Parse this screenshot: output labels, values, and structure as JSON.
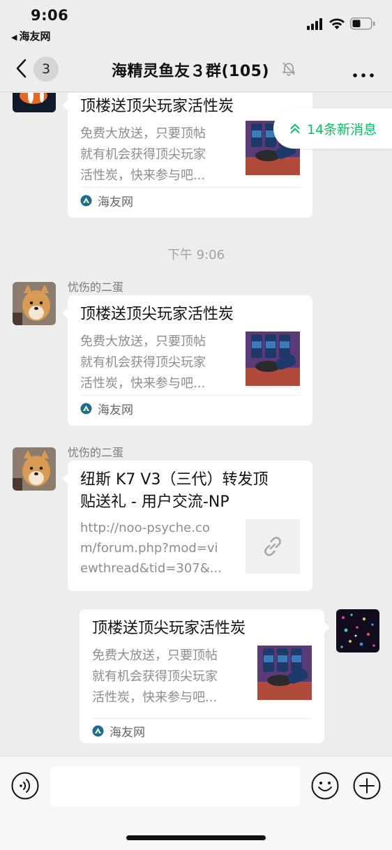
{
  "status_bar": {
    "time": "9:06",
    "back_app": "海友网"
  },
  "nav": {
    "back_count": "3",
    "title": "海精灵鱼友３群(105)"
  },
  "new_messages": {
    "label": "14条新消息"
  },
  "messages": [
    {
      "card": {
        "title": "顶楼送顶尖玩家活性炭",
        "desc_lines": [
          "免费大放送，只要顶帖",
          "就有机会获得顶尖玩家",
          "活性炭，快来参与吧..."
        ],
        "source": "海友网"
      }
    },
    {
      "timestamp": "下午 9:06"
    },
    {
      "sender": "忧伤的二蛋",
      "card": {
        "title": "顶楼送顶尖玩家活性炭",
        "desc_lines": [
          "免费大放送，只要顶帖",
          "就有机会获得顶尖玩家",
          "活性炭，快来参与吧..."
        ],
        "source": "海友网"
      }
    },
    {
      "sender": "忧伤的二蛋",
      "card": {
        "title_lines": [
          "纽斯 K7 V3（三代）转发顶",
          "贴送礼 - 用户交流-NP"
        ],
        "desc_lines": [
          "http://noo-psyche.co",
          "m/forum.php?mod=vi",
          "ewthread&tid=307&..."
        ]
      }
    },
    {
      "card": {
        "title": "顶楼送顶尖玩家活性炭",
        "desc_lines": [
          "免费大放送，只要顶帖",
          "就有机会获得顶尖玩家",
          "活性炭，快来参与吧..."
        ],
        "source": "海友网"
      }
    }
  ],
  "icons": {
    "back": "chevron-left-icon",
    "mute": "bell-slash-icon",
    "more": "more-dots-icon",
    "new_messages": "double-chevron-up-icon",
    "voice": "voice-icon",
    "emoji": "emoji-icon",
    "plus": "plus-icon",
    "link": "link-icon",
    "source": "haiyou-logo-icon"
  },
  "colors": {
    "background": "#ededed",
    "accent_green": "#07c160",
    "card": "#ffffff",
    "meta_text": "#8d8d8d"
  }
}
